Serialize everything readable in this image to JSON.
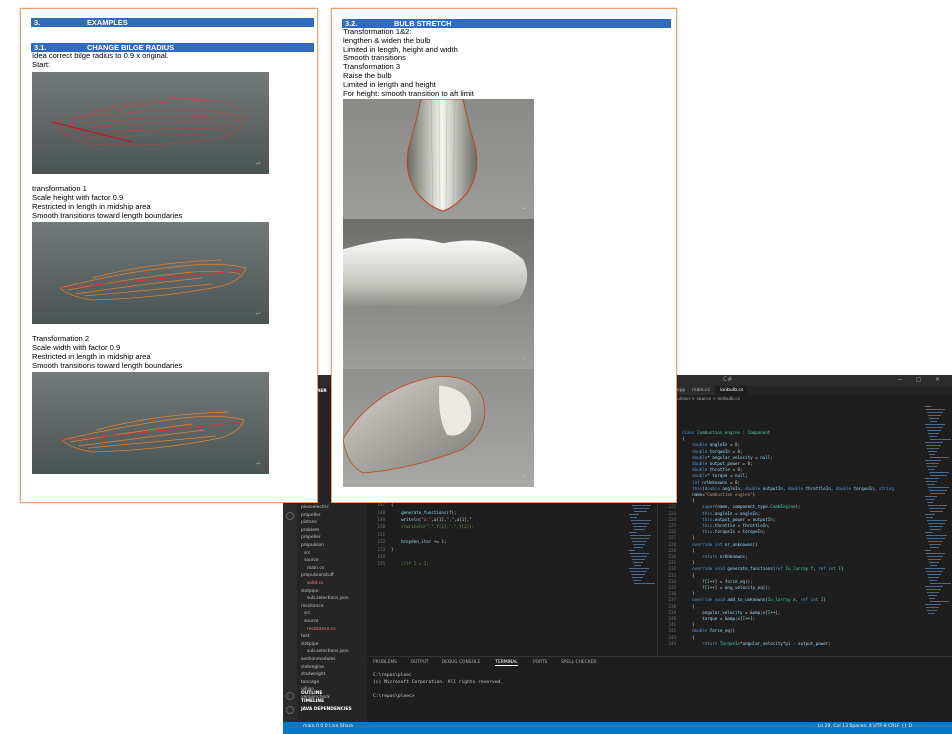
{
  "page1": {
    "section_num": "3.",
    "section_title": "EXAMPLES",
    "sub_num": "3.1.",
    "sub_title": "CHANGE BILGE RADIUS",
    "intro": [
      "Idea correct bilge radius to 0.9 x original.",
      "Start:"
    ],
    "t1": [
      "transformation 1",
      "Scale height with factor 0.9",
      "Restricted in length in midship area",
      "Smooth transitions toward length boundaries"
    ],
    "t2": [
      "Transformation 2",
      "Scale width with factor 0.9",
      "Restricted in length in midship area",
      "Smooth transitions toward length boundaries"
    ]
  },
  "page2": {
    "sub_num": "3.2.",
    "sub_title": "BULB STRETCH",
    "lines": [
      "Transformation 1&2:",
      "lengthen & widen the bulb",
      "Limited in length, height and width",
      "Smooth transitions",
      "Transformation 3",
      "Raise the bulb",
      "Limited in length and height",
      "For height: smooth transition to aft limit"
    ]
  },
  "vscode": {
    "title": "C#",
    "tabs": [
      "main.cpp",
      "main.cs",
      "ionbulb.cs"
    ],
    "breadcrumb": "> propulsion > source > ionbulb.cs",
    "explorer_header": "EXPLORER",
    "explorer_items": [
      "piezoelectric",
      "propeller",
      "pistons",
      "problem",
      "propeller",
      "propulsion",
      "src",
      "source",
      "main.cs",
      "propulsionstuff",
      "solid.cs",
      "slotpipe",
      "sub.selections.json",
      "resistance",
      "src",
      "source",
      "resistance.cs",
      "test",
      "slotpipe",
      "sub.selections.json",
      "sectionmodules",
      "slotengine",
      "stadweight",
      "tonnage",
      "uillion",
      "versioncheck"
    ],
    "outline_items": [
      "OUTLINE",
      "TIMELINE",
      "JAVA DEPENDENCIES"
    ],
    "code_left": [
      "component.test_add_to_unknown(a, b);",
      "",
      "int I = 1;",
      "foreach (Component component: components_array)",
      "{",
      "    component.test_generate_functions(F, I);",
      "}",
      "",
      "void func_index_normal(int a,",
      "        int Iu_larray a,",
      "        int Iu_larray f,",
      "        void* extra_info,",
      "        int bool application_wants_to_stop)",
      "{",
      "    generate_functions(f);",
      "    writeln(\"x:\",a[1],\",\",a[1],\"",
      "    //writeln(\",\",f[1],\",\",f[2]);",
      "",
      "    breyden_iter += 1;",
      "}",
      "",
      "    //if I = 1;"
    ],
    "code_right": [
      "class Combustion_engine : Component",
      "{",
      "    double angleIn = 0;",
      "    double torqueIn = 0;",
      "    double* angular_velocity = null;",
      "    double output_power = 0;",
      "    double throttle = 0;",
      "    double* torque = null;",
      "    int nrUnknowns = 0;",
      "    this(double angleIn, double outputIn, double throttleIn, double torqueIn, string",
      "    name=\"Combustion engine\")",
      "    {",
      "        super(name, component_type.CombEngine);",
      "        this.angleIn = angleIn;",
      "        this.output_power = outputIn;",
      "        this.throttle = throttleIn;",
      "        this.torqueIn = torqueIn;",
      "    }",
      "    override int nr_unknowns()",
      "    {",
      "        return nrUnknowns;",
      "    }",
      "    override void generate_functions(ref Iu_larray f, ref int I)",
      "    {",
      "        f[I++] = force_eq();",
      "        f[I++] = ang_velocity_eq();",
      "    }",
      "    override void add_to_unknowns(Iu_larray x, ref int I)",
      "    {",
      "        angular_velocity = &x[I++];",
      "        torque = &x[I++];",
      "    }",
      "    double force_eq()",
      "    {",
      "        return TorqueIn*angular_velocity*pi - output_power;"
    ],
    "panel_tabs": [
      "PROBLEMS",
      "OUTPUT",
      "DEBUG CONSOLE",
      "TERMINAL",
      "PORTS",
      "SPELL CHECKER"
    ],
    "terminal_lines": [
      "C:\\repos\\ploec",
      "(c) Microsoft Corporation. All rights reserved.",
      "",
      "C:\\repos\\ploec>"
    ],
    "status_left": "main  0 0  0  Live Share",
    "status_right": "Ln 29, Col 13  Spaces: 4  UTF-8  CRLF  {} D"
  },
  "colors": {
    "heading_bar": "#2f6bbf",
    "page_border": "#f0a062",
    "status_bar": "#007acc"
  }
}
